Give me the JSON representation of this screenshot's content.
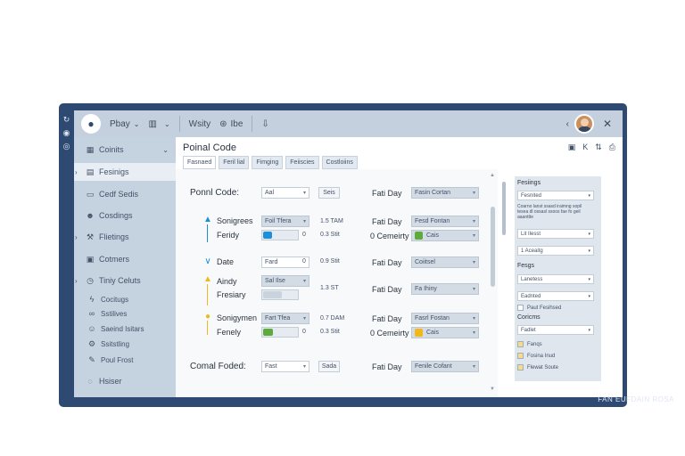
{
  "left_strip": {
    "icons": [
      "refresh-icon",
      "globe-icon",
      "eye-icon"
    ]
  },
  "topbar": {
    "logo_icon": "apple-logo-icon",
    "items": [
      {
        "icon": "",
        "label": "Pbay",
        "chevron": "⌄"
      },
      {
        "icon": "chart-icon",
        "label": "",
        "chevron": "⌄"
      },
      {
        "icon": "",
        "label": "Wsity",
        "chevron": ""
      },
      {
        "icon": "tag-icon",
        "label": "Ibe",
        "chevron": ""
      },
      {
        "icon": "download-icon",
        "label": "",
        "chevron": ""
      }
    ],
    "collapse_glyph": "‹",
    "close_glyph": "✕"
  },
  "sidebar": {
    "items": [
      {
        "icon": "grid-icon",
        "label": "Coinits",
        "trail": "⌄",
        "exp": ""
      },
      {
        "icon": "doc-icon",
        "label": "Fesinigs",
        "trail": "",
        "exp": "›",
        "active": true
      },
      {
        "icon": "folder-icon",
        "label": "Cedf Sedis",
        "trail": "",
        "exp": ""
      },
      {
        "icon": "people-icon",
        "label": "Cosdings",
        "trail": "",
        "exp": ""
      },
      {
        "icon": "wrench-icon",
        "label": "Flietings",
        "trail": "",
        "exp": "›"
      },
      {
        "icon": "table-icon",
        "label": "Cotmers",
        "trail": "",
        "exp": ""
      },
      {
        "icon": "clock-icon",
        "label": "Tiniy Celuts",
        "trail": "",
        "exp": "›"
      },
      {
        "icon": "bolt-icon",
        "label": "Cocitugs",
        "trail": "",
        "exp": "",
        "sub": true
      },
      {
        "icon": "link-icon",
        "label": "Sstilives",
        "trail": "",
        "exp": "",
        "sub": true
      },
      {
        "icon": "user-icon",
        "label": "Saeind Isitars",
        "trail": "",
        "exp": "",
        "sub": true
      },
      {
        "icon": "gear-icon",
        "label": "Ssitstling",
        "trail": "",
        "exp": "",
        "sub": true
      },
      {
        "icon": "pin-icon",
        "label": "Poul Frost",
        "trail": "",
        "exp": "",
        "sub": true
      },
      {
        "icon": "help-icon",
        "label": "Hsiser",
        "trail": "",
        "exp": ""
      }
    ]
  },
  "main": {
    "title": "Poinal Code",
    "tabs": [
      "Fasnaed",
      "Feril lial",
      "Fimging",
      "Feiiscies",
      "Costloiins"
    ],
    "rows": {
      "postal": {
        "label": "Ponnl Code:",
        "input": "Aal",
        "btn": "Seis",
        "right_label": "Fati Day",
        "select": "Fasin Cortan"
      },
      "r2a": {
        "label": "Sonigrees",
        "input": "Foil Tfera",
        "value": "1.5 TAM",
        "right_label": "Fati Day",
        "select": "Fesd Fontan"
      },
      "r2b": {
        "label": "Feridy",
        "step": "0",
        "value": "0.3 Stit",
        "right_label": "0 Cemeirty",
        "select": "Cais",
        "fill": 0.25,
        "swatch": "#e6ecf2"
      },
      "r3": {
        "label": "Date",
        "input": "Fard",
        "step": "0",
        "value": "0.9 Stit",
        "right_label": "Fati Day",
        "select": "Coiitsel"
      },
      "r4a": {
        "label": "Aindy",
        "input": "Sal Ilse",
        "right_label": "Fati Day",
        "select": "Fa Ihiny"
      },
      "r4b": {
        "label": "Fresiary",
        "value": "1.3 ST",
        "fill": 0.55
      },
      "r5a": {
        "label": "Sonigymen",
        "input": "Fart Tfea",
        "value": "0.7 DAM",
        "right_label": "Fati Day",
        "select": "Fasrl Fostan"
      },
      "r5b": {
        "label": "Fenely",
        "step": "0",
        "value": "0.3 Stit",
        "right_label": "0 Cemeirty",
        "select": "Cais",
        "fill": 0.3
      },
      "final": {
        "label": "Comal Foded:",
        "input": "Fast",
        "btn": "Sada",
        "right_label": "Fati Day",
        "select": "Fenile Cofant"
      }
    },
    "colors": {
      "blue": "#1e8fd6",
      "green": "#5cab3c",
      "yellow": "#f2b71b",
      "navy": "#2f4a72"
    }
  },
  "right_panel": {
    "tools": [
      "▣",
      "K",
      "⇅",
      "⎙"
    ],
    "heading": "Fesiings",
    "field1": "Fesnited",
    "desc": "Coarno lanst ssasd iraimng sopil tesea dl ossasl ssoos fae fo geil aaanttte",
    "field2": "Lit Ilesst",
    "field3": "1 Aceaitg",
    "sub_heading": "Fesgs",
    "field4": "Lanetess",
    "field5": "Eadnted",
    "check1": "Paut Fesihsed",
    "label_c": "Coricms",
    "field6": "Fadlet",
    "checks": [
      "Fanqs",
      "Fosina Inud",
      "Flewat Soute"
    ],
    "check_color": "#f6dc86"
  },
  "footer": "FAN EUFDAIN ROSA"
}
